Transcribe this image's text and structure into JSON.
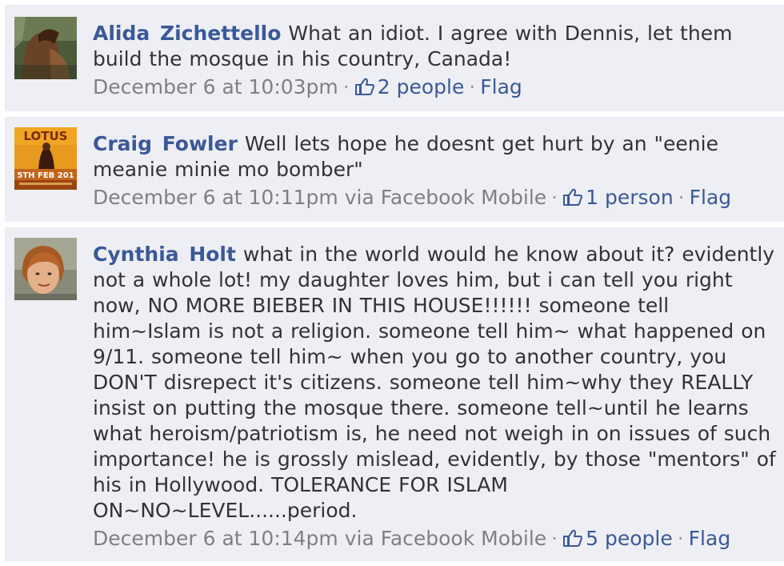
{
  "comments": [
    {
      "author": "Alida Zichettello",
      "text": "What an idiot. I agree with Dennis, let them build the mosque in his country, Canada!",
      "timestamp": "December 6 at 10:03pm",
      "via": "",
      "likes": "2 people",
      "flag": "Flag",
      "avatar_icon": "profile-photo-horse"
    },
    {
      "author": "Craig Fowler",
      "text": "Well lets hope he doesnt get hurt by an \"eenie meanie minie mo bomber\"",
      "timestamp": "December 6 at 10:11pm",
      "via": "via Facebook Mobile",
      "likes": "1 person",
      "flag": "Flag",
      "avatar_icon": "profile-photo-poster",
      "avatar_text": [
        "LOTUS",
        "5TH FEB 201"
      ]
    },
    {
      "author": "Cynthia Holt",
      "text": "what in the world would he know about it? evidently not a whole lot! my daughter loves him, but i can tell you right now, NO MORE BIEBER IN THIS HOUSE!!!!!! someone tell him~Islam is not a religion. someone tell him~ what happened on 9/11. someone tell him~ when you go to another country, you DON'T disrepect it's citizens. someone tell him~why they REALLY insist on putting the mosque there. someone tell~until he learns what heroism/patriotism is, he need not weigh in on issues of such importance! he is grossly mislead, evidently, by those \"mentors\" of his in Hollywood. TOLERANCE FOR ISLAM ON~NO~LEVEL......period.",
      "timestamp": "December 6 at 10:14pm",
      "via": "via Facebook Mobile",
      "likes": "5 people",
      "flag": "Flag",
      "avatar_icon": "profile-photo-woman"
    }
  ],
  "separator": "·",
  "colors": {
    "link": "#3b5998",
    "meta": "#808080",
    "background": "#edeff4",
    "text": "#333333"
  },
  "icons": {
    "like": "thumbs-up-icon"
  }
}
